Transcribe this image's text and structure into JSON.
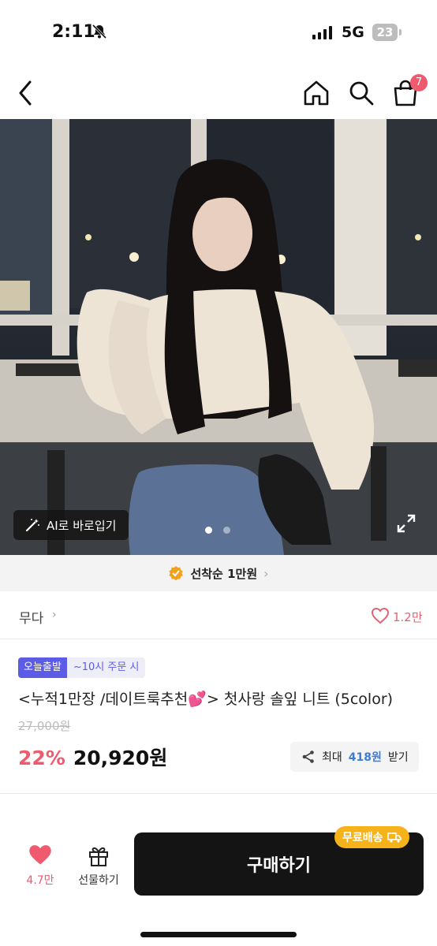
{
  "status_bar": {
    "time": "2:11",
    "network": "5G",
    "battery": "23",
    "icons": [
      "bell-slash-icon",
      "signal-icon",
      "battery-icon"
    ]
  },
  "nav": {
    "icons": [
      "back-icon",
      "home-icon",
      "search-icon",
      "cart-icon"
    ],
    "cart_count": "7"
  },
  "gallery": {
    "ai_button_label": "AI로 바로입기",
    "page_count": 2,
    "current_page": 1
  },
  "coupon": {
    "label": "선착순 1만원",
    "chevron": "›"
  },
  "shop": {
    "name": "무다",
    "chevron": "›",
    "likes": "1.2만"
  },
  "product": {
    "tag_today": "오늘출발",
    "tag_order": "~10시 주문 시",
    "title": "<누적1만장 /데이트룩추천💕> 첫사랑 솔잎 니트 (5color)",
    "original_price": "27,000원",
    "discount": "22%",
    "price": "20,920원",
    "reward": {
      "prefix": "최대",
      "amount": "418원",
      "suffix": "받기"
    }
  },
  "bottom_bar": {
    "like_count": "4.7만",
    "gift_label": "선물하기",
    "buy_label": "구매하기",
    "free_shipping_label": "무료배송"
  },
  "colors": {
    "accent_pink": "#ef5a6f",
    "tag_purple": "#5c5ce6",
    "reward_blue": "#3a7be0",
    "free_ship_yellow": "#f6b21a",
    "buy_button": "#141414"
  }
}
